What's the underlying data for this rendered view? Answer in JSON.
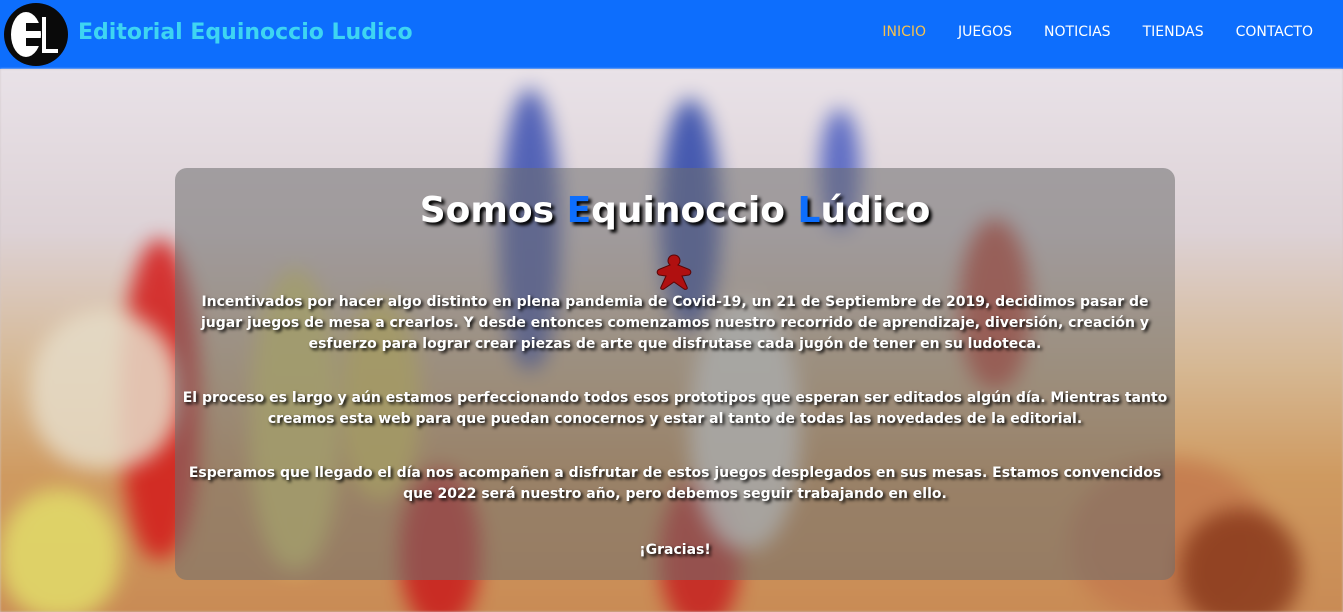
{
  "brand": {
    "name": "Editorial Equinoccio Ludico",
    "logo_icon": "el-logo-icon"
  },
  "nav": {
    "items": [
      {
        "label": "INICIO",
        "active": true
      },
      {
        "label": "JUEGOS",
        "active": false
      },
      {
        "label": "NOTICIAS",
        "active": false
      },
      {
        "label": "TIENDAS",
        "active": false
      },
      {
        "label": "CONTACTO",
        "active": false
      }
    ]
  },
  "hero": {
    "title_parts": [
      "Somos ",
      "E",
      "quinoccio ",
      "L",
      "údico"
    ],
    "icon": "meeple-icon",
    "paragraphs": [
      "Incentivados por hacer algo distinto en plena pandemia de Covid-19, un 21 de Septiembre de 2019, decidimos pasar de jugar juegos de mesa a crearlos. Y desde entonces comenzamos nuestro recorrido de aprendizaje, diversión, creación y esfuerzo para lograr crear piezas de arte que disfrutase cada jugón de tener en su ludoteca.",
      "El proceso es largo y aún estamos perfeccionando todos esos prototipos que esperan ser editados algún día. Mientras tanto creamos esta web para que puedan conocernos y estar al tanto de todas las novedades de la editorial.",
      "Esperamos que llegado el día nos acompañen a disfrutar de estos juegos desplegados en sus mesas. Estamos convencidos que 2022 será nuestro año, pero debemos seguir trabajando en ello.",
      "¡Gracias!"
    ]
  },
  "colors": {
    "navbar": "#0d6efd",
    "brand_text": "#3ed5f2",
    "nav_active": "#f6c14e",
    "nav_text": "#ffffff",
    "title_highlight": "#0d6efd",
    "meeple": "#b01010"
  }
}
